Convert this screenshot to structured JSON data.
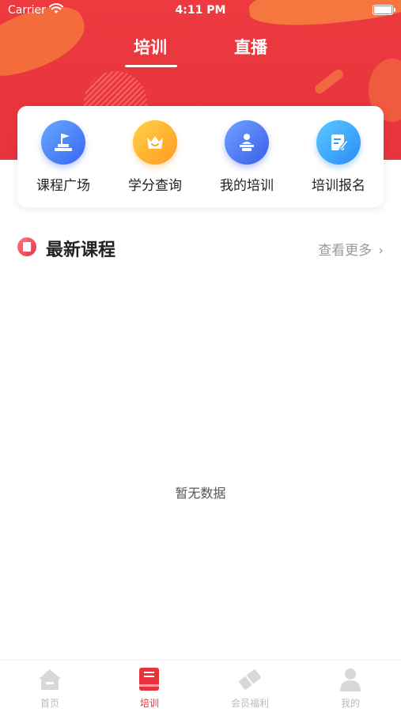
{
  "status_bar": {
    "carrier": "Carrier",
    "time": "4:11 PM"
  },
  "top_tabs": [
    {
      "label": "培训",
      "active": true
    },
    {
      "label": "直播",
      "active": false
    }
  ],
  "quick_actions": [
    {
      "label": "课程广场",
      "icon": "flag-podium-icon"
    },
    {
      "label": "学分查询",
      "icon": "crown-icon"
    },
    {
      "label": "我的培训",
      "icon": "lecturer-icon"
    },
    {
      "label": "培训报名",
      "icon": "edit-form-icon"
    }
  ],
  "section": {
    "title": "最新课程",
    "more_label": "查看更多"
  },
  "empty_state": {
    "text": "暂无数据"
  },
  "bottom_nav": [
    {
      "label": "首页",
      "icon": "home-icon",
      "active": false
    },
    {
      "label": "培训",
      "icon": "book-icon",
      "active": true
    },
    {
      "label": "会员福利",
      "icon": "ticket-icon",
      "active": false
    },
    {
      "label": "我的",
      "icon": "user-icon",
      "active": false
    }
  ],
  "colors": {
    "brand_red": "#e8333c",
    "accent_orange": "#f5763f"
  }
}
